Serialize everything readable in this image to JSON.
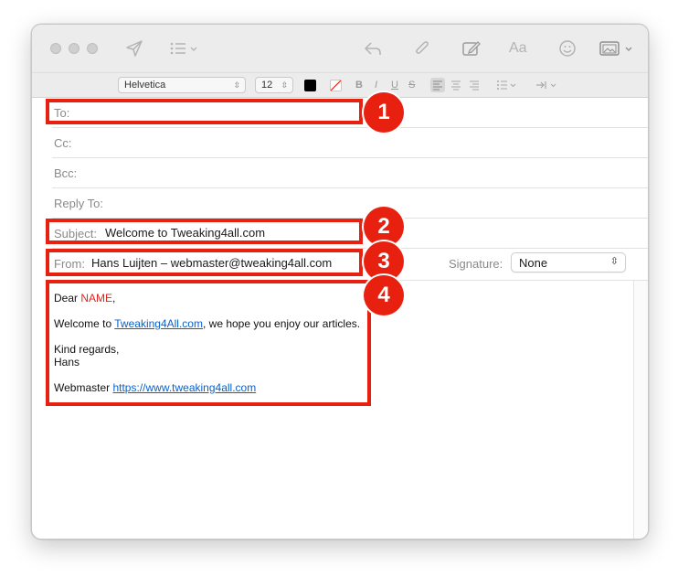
{
  "toolbar": {
    "icons": [
      "send-icon",
      "list-format-icon",
      "reply-icon",
      "attachment-icon",
      "markup-icon",
      "font-icon",
      "emoji-icon",
      "photo-browser-icon"
    ],
    "font_icon_text": "Aa"
  },
  "format_bar": {
    "font_family": "Helvetica",
    "font_size": "12",
    "text_color": "#000000",
    "bold": "B",
    "italic": "I",
    "underline": "U",
    "strikethrough": "S"
  },
  "fields": {
    "to_label": "To:",
    "to_value": "",
    "cc_label": "Cc:",
    "bcc_label": "Bcc:",
    "reply_to_label": "Reply To:",
    "subject_label": "Subject:",
    "subject_value": "Welcome to Tweaking4all.com",
    "from_label": "From:",
    "from_value": "Hans Luijten – webmaster@tweaking4all.com",
    "signature_label": "Signature:",
    "signature_value": "None"
  },
  "message": {
    "greeting_prefix": "Dear ",
    "greeting_name": "NAME",
    "greeting_suffix": ",",
    "welcome_prefix": "Welcome to ",
    "welcome_link": "Tweaking4All.com",
    "welcome_suffix": ", we hope you enjoy our articles.",
    "closing": "Kind regards,",
    "name": "Hans",
    "webmaster_prefix": "Webmaster ",
    "webmaster_link": "https://www.tweaking4all.com"
  },
  "annotations": {
    "badge_1": "1",
    "badge_2": "2",
    "badge_3": "3",
    "badge_4": "4",
    "highlight_color": "#e8200f"
  }
}
